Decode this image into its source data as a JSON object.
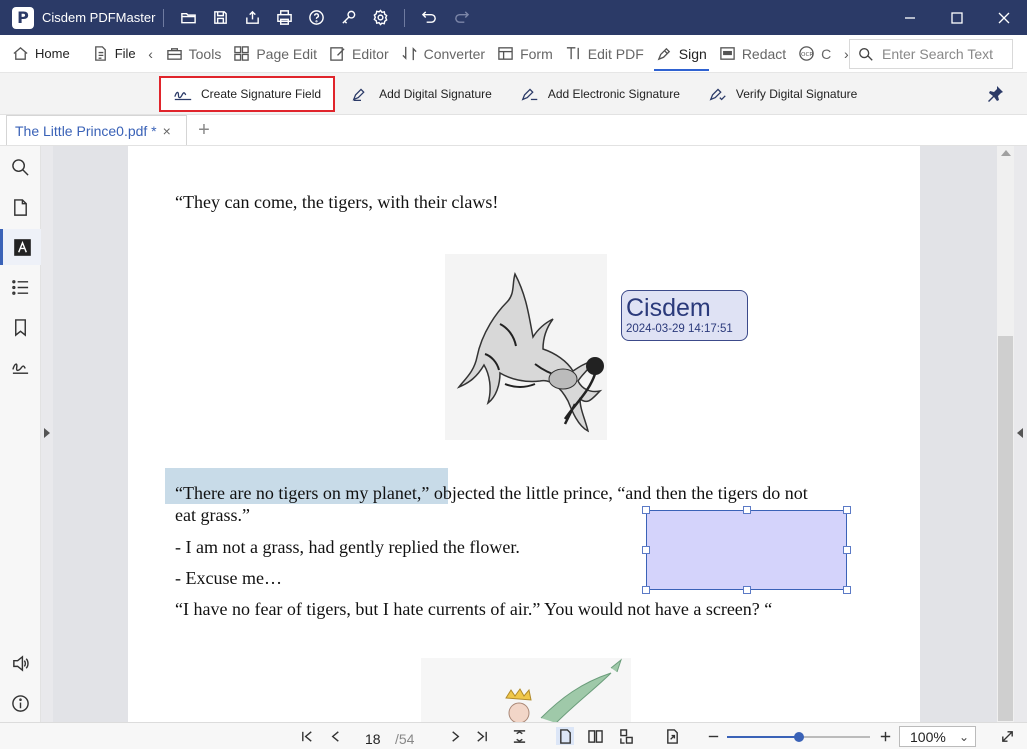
{
  "app": {
    "title": "Cisdem PDFMaster",
    "logo_letter": "P"
  },
  "titlebar_icons": [
    "open-folder-icon",
    "save-icon",
    "share-icon",
    "print-icon",
    "help-icon",
    "key-icon",
    "settings-icon",
    "undo-icon",
    "redo-icon"
  ],
  "menu": {
    "home": "Home",
    "file": "File",
    "tools": "Tools",
    "page_edit": "Page Edit",
    "editor": "Editor",
    "converter": "Converter",
    "form": "Form",
    "edit_pdf": "Edit PDF",
    "sign": "Sign",
    "redact": "Redact",
    "ocr_fragment": "C",
    "search_placeholder": "Enter Search Text"
  },
  "sign_toolbar": {
    "create_field": "Create Signature Field",
    "add_digital": "Add Digital Signature",
    "add_electronic": "Add Electronic Signature",
    "verify_digital": "Verify Digital Signature"
  },
  "tab": {
    "title": "The Little Prince0.pdf *",
    "close": "×",
    "add": "+"
  },
  "document": {
    "line1": "“They can come, the tigers, with their claws!",
    "line2a": "“There are no tigers on my planet,”",
    "line2b": " objected the little prince, “and then the tigers do not",
    "line3": "eat grass.”",
    "line4": "- I am not a grass, had gently replied the flower.",
    "line5": "- Excuse me…",
    "line6": "“I have no fear of tigers, but I hate currents of air.” You would not have a screen? “",
    "signature": {
      "name": "Cisdem",
      "date": "2024-03-29 14:17:51"
    }
  },
  "status": {
    "current_page": "18",
    "total_pages": "/54",
    "zoom": "100%",
    "zoom_fraction": 0.5
  },
  "colors": {
    "titlebar": "#2b3a67",
    "accent": "#3a62b7",
    "highlight_border": "#e0242b",
    "signature_field": "#d4d3fb"
  }
}
